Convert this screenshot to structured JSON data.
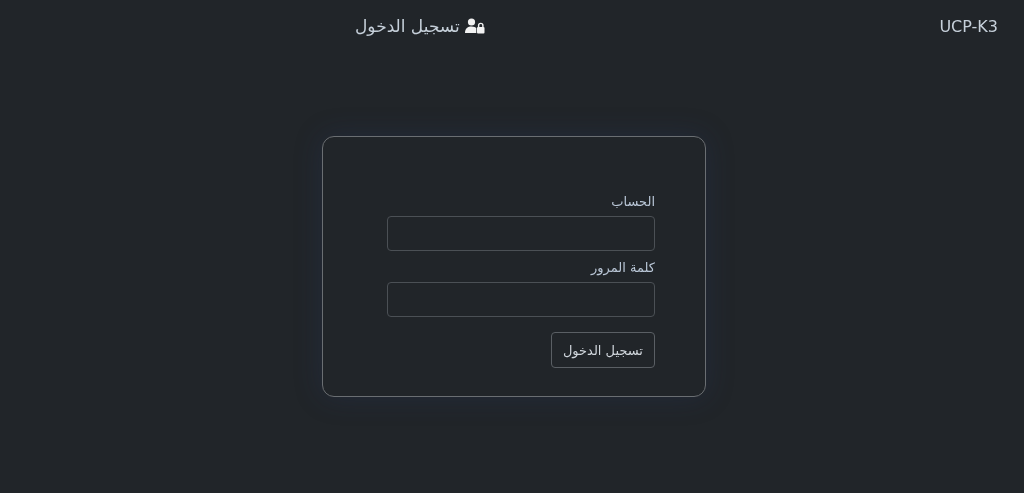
{
  "navbar": {
    "brand": "UCP-K3",
    "login_link": "تسجيل الدخول"
  },
  "login_form": {
    "fields": [
      {
        "label": "الحساب"
      },
      {
        "label": "كلمة المرور"
      }
    ],
    "submit": "تسجيل الدخول"
  }
}
